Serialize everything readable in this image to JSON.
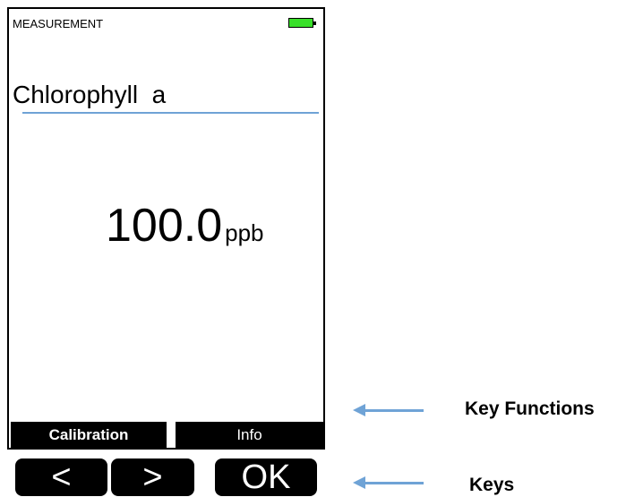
{
  "screen": {
    "mode_label": "MEASUREMENT",
    "battery_icon": "battery-full-icon",
    "battery_color": "#39e02a",
    "parameter": "Chlorophyll  a",
    "reading": {
      "value": "100.0",
      "unit": "ppb"
    }
  },
  "softkeys": {
    "calibration": "Calibration",
    "info": "Info"
  },
  "hardware_keys": {
    "left": "<",
    "right": ">",
    "ok": "OK"
  },
  "annotations": {
    "key_functions": "Key Functions",
    "keys": "Keys"
  },
  "colors": {
    "accent": "#6fa3d6",
    "key_bg": "#000000",
    "key_text": "#ffffff"
  }
}
